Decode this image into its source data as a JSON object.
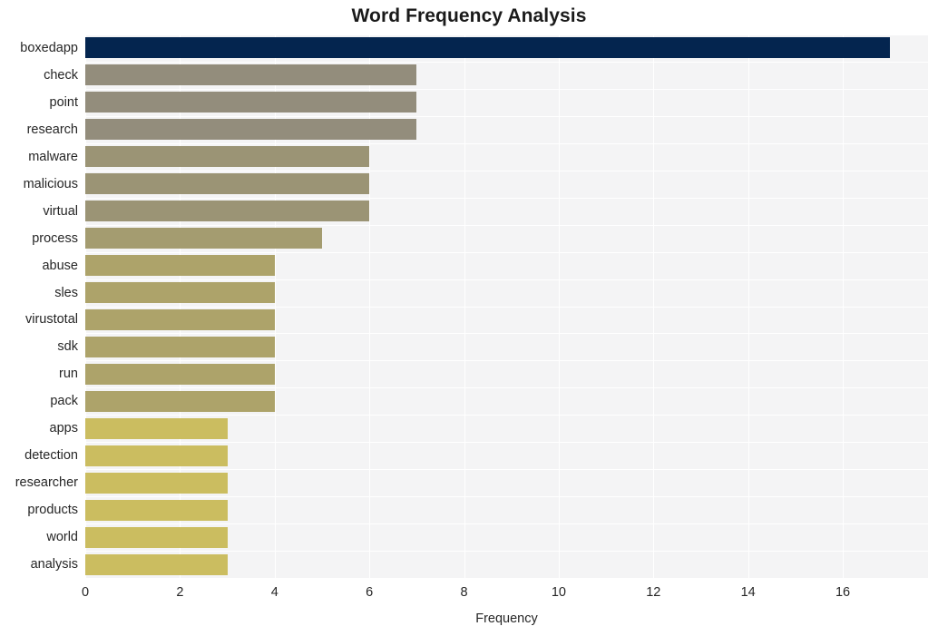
{
  "chart_data": {
    "type": "bar",
    "orientation": "horizontal",
    "title": "Word Frequency Analysis",
    "xlabel": "Frequency",
    "ylabel": "",
    "categories": [
      "boxedapp",
      "check",
      "point",
      "research",
      "malware",
      "malicious",
      "virtual",
      "process",
      "abuse",
      "sles",
      "virustotal",
      "sdk",
      "run",
      "pack",
      "apps",
      "detection",
      "researcher",
      "products",
      "world",
      "analysis"
    ],
    "values": [
      17,
      7,
      7,
      7,
      6,
      6,
      6,
      5,
      4,
      4,
      4,
      4,
      4,
      4,
      3,
      3,
      3,
      3,
      3,
      3
    ],
    "bar_colors": [
      "#04254f",
      "#938d7c",
      "#938d7c",
      "#938d7c",
      "#9b9475",
      "#9b9475",
      "#9b9475",
      "#a49c70",
      "#ada36a",
      "#ada36a",
      "#ada36a",
      "#ada36a",
      "#ada36a",
      "#ada36a",
      "#cbbd60",
      "#cbbd60",
      "#cbbd60",
      "#cbbd60",
      "#cbbd60",
      "#cbbd60"
    ],
    "xticks": [
      0,
      2,
      4,
      6,
      8,
      10,
      12,
      14,
      16
    ],
    "xtick_labels": [
      "0",
      "2",
      "4",
      "6",
      "8",
      "10",
      "12",
      "14",
      "16"
    ],
    "xlim": [
      0,
      17.8
    ],
    "grid": true,
    "grid_color": "#ffffff",
    "plot_background": "#f4f4f5",
    "figure_background": "#ffffff",
    "legend": null
  }
}
